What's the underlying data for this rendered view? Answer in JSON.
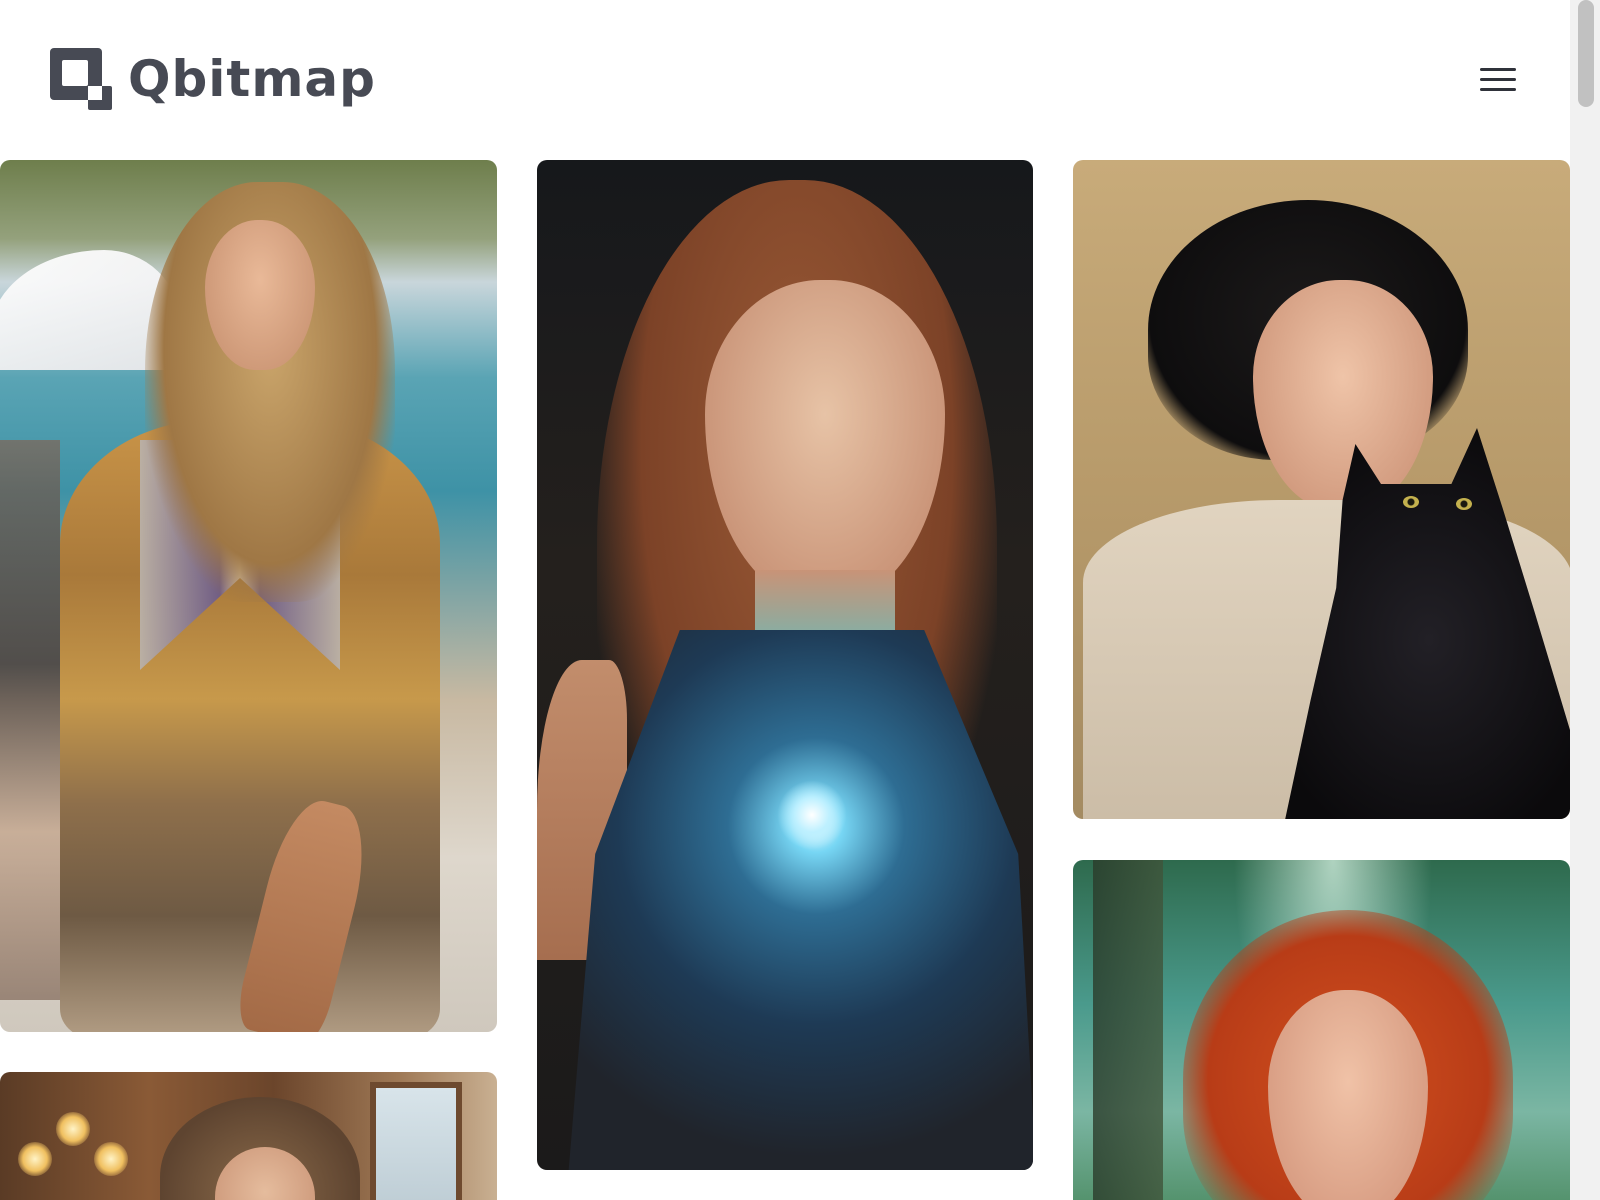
{
  "brand": {
    "name": "Qbitmap",
    "logo_icon": "qbitmap-logo-icon",
    "text_color": "#474a54"
  },
  "header": {
    "menu_icon": "hamburger-menu-icon"
  },
  "gallery": {
    "items": [
      {
        "subject": "woman-runway-boho-dress"
      },
      {
        "subject": "woman-glowing-suit"
      },
      {
        "subject": "woman-with-black-cat"
      },
      {
        "subject": "redhead-woman-forest"
      },
      {
        "subject": "woman-cafe"
      }
    ]
  },
  "scrollbar": {
    "position_fraction": 0.0
  }
}
